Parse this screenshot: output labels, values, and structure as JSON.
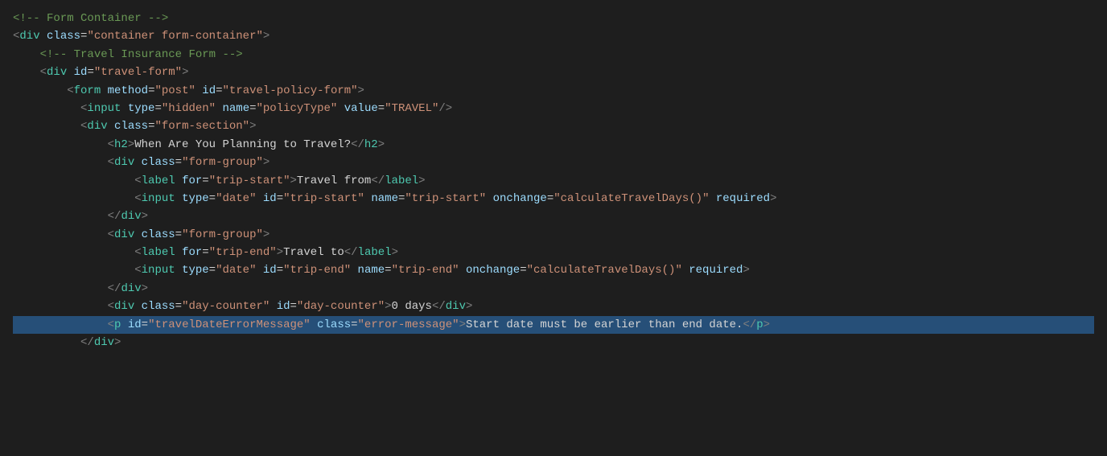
{
  "editor": {
    "background": "#1e1e1e",
    "lines": [
      {
        "id": 1,
        "highlighted": false,
        "tokens": [
          {
            "type": "comment",
            "text": "<!-- Form Container -->"
          }
        ]
      },
      {
        "id": 2,
        "highlighted": false,
        "tokens": [
          {
            "type": "bracket",
            "text": "<"
          },
          {
            "type": "element-name",
            "text": "div"
          },
          {
            "type": "plain",
            "text": " "
          },
          {
            "type": "attr-name",
            "text": "class"
          },
          {
            "type": "equals",
            "text": "="
          },
          {
            "type": "attr-value",
            "text": "\"container form-container\""
          },
          {
            "type": "bracket",
            "text": ">"
          }
        ]
      },
      {
        "id": 3,
        "highlighted": false,
        "indent": "    ",
        "tokens": [
          {
            "type": "comment",
            "text": "<!-- Travel Insurance Form -->"
          }
        ]
      },
      {
        "id": 4,
        "highlighted": false,
        "indent": "    ",
        "tokens": [
          {
            "type": "bracket",
            "text": "<"
          },
          {
            "type": "element-name",
            "text": "div"
          },
          {
            "type": "plain",
            "text": " "
          },
          {
            "type": "attr-name",
            "text": "id"
          },
          {
            "type": "equals",
            "text": "="
          },
          {
            "type": "attr-value",
            "text": "\"travel-form\""
          },
          {
            "type": "bracket",
            "text": ">"
          }
        ]
      },
      {
        "id": 5,
        "highlighted": false,
        "indent": "        ",
        "tokens": [
          {
            "type": "bracket",
            "text": "<"
          },
          {
            "type": "element-name",
            "text": "form"
          },
          {
            "type": "plain",
            "text": " "
          },
          {
            "type": "attr-name",
            "text": "method"
          },
          {
            "type": "equals",
            "text": "="
          },
          {
            "type": "attr-value",
            "text": "\"post\""
          },
          {
            "type": "plain",
            "text": " "
          },
          {
            "type": "attr-name",
            "text": "id"
          },
          {
            "type": "equals",
            "text": "="
          },
          {
            "type": "attr-value",
            "text": "\"travel-policy-form\""
          },
          {
            "type": "bracket",
            "text": ">"
          }
        ]
      },
      {
        "id": 6,
        "highlighted": false,
        "indent": "          ",
        "tokens": [
          {
            "type": "bracket",
            "text": "<"
          },
          {
            "type": "element-name",
            "text": "input"
          },
          {
            "type": "plain",
            "text": " "
          },
          {
            "type": "attr-name",
            "text": "type"
          },
          {
            "type": "equals",
            "text": "="
          },
          {
            "type": "attr-value",
            "text": "\"hidden\""
          },
          {
            "type": "plain",
            "text": " "
          },
          {
            "type": "attr-name",
            "text": "name"
          },
          {
            "type": "equals",
            "text": "="
          },
          {
            "type": "attr-value",
            "text": "\"policyType\""
          },
          {
            "type": "plain",
            "text": " "
          },
          {
            "type": "attr-name",
            "text": "value"
          },
          {
            "type": "equals",
            "text": "="
          },
          {
            "type": "attr-value",
            "text": "\"TRAVEL\""
          },
          {
            "type": "bracket",
            "text": "/>"
          }
        ]
      },
      {
        "id": 7,
        "highlighted": false,
        "indent": "          ",
        "tokens": [
          {
            "type": "bracket",
            "text": "<"
          },
          {
            "type": "element-name",
            "text": "div"
          },
          {
            "type": "plain",
            "text": " "
          },
          {
            "type": "attr-name",
            "text": "class"
          },
          {
            "type": "equals",
            "text": "="
          },
          {
            "type": "attr-value",
            "text": "\"form-section\""
          },
          {
            "type": "bracket",
            "text": ">"
          }
        ]
      },
      {
        "id": 8,
        "highlighted": false,
        "indent": "              ",
        "tokens": [
          {
            "type": "bracket",
            "text": "<"
          },
          {
            "type": "element-name",
            "text": "h2"
          },
          {
            "type": "bracket",
            "text": ">"
          },
          {
            "type": "h2-content",
            "text": "When Are You Planning to Travel?"
          },
          {
            "type": "bracket",
            "text": "</"
          },
          {
            "type": "element-name",
            "text": "h2"
          },
          {
            "type": "bracket",
            "text": ">"
          }
        ]
      },
      {
        "id": 9,
        "highlighted": false,
        "indent": "              ",
        "tokens": [
          {
            "type": "bracket",
            "text": "<"
          },
          {
            "type": "element-name",
            "text": "div"
          },
          {
            "type": "plain",
            "text": " "
          },
          {
            "type": "attr-name",
            "text": "class"
          },
          {
            "type": "equals",
            "text": "="
          },
          {
            "type": "attr-value",
            "text": "\"form-group\""
          },
          {
            "type": "bracket",
            "text": ">"
          }
        ]
      },
      {
        "id": 10,
        "highlighted": false,
        "indent": "                  ",
        "tokens": [
          {
            "type": "bracket",
            "text": "<"
          },
          {
            "type": "element-name",
            "text": "label"
          },
          {
            "type": "plain",
            "text": " "
          },
          {
            "type": "attr-name",
            "text": "for"
          },
          {
            "type": "equals",
            "text": "="
          },
          {
            "type": "attr-value",
            "text": "\"trip-start\""
          },
          {
            "type": "bracket",
            "text": ">"
          },
          {
            "type": "text-content",
            "text": "Travel from"
          },
          {
            "type": "bracket",
            "text": "</"
          },
          {
            "type": "element-name",
            "text": "label"
          },
          {
            "type": "bracket",
            "text": ">"
          }
        ]
      },
      {
        "id": 11,
        "highlighted": false,
        "indent": "                  ",
        "tokens": [
          {
            "type": "bracket",
            "text": "<"
          },
          {
            "type": "element-name",
            "text": "input"
          },
          {
            "type": "plain",
            "text": " "
          },
          {
            "type": "attr-name",
            "text": "type"
          },
          {
            "type": "equals",
            "text": "="
          },
          {
            "type": "attr-value",
            "text": "\"date\""
          },
          {
            "type": "plain",
            "text": " "
          },
          {
            "type": "attr-name",
            "text": "id"
          },
          {
            "type": "equals",
            "text": "="
          },
          {
            "type": "attr-value",
            "text": "\"trip-start\""
          },
          {
            "type": "plain",
            "text": " "
          },
          {
            "type": "attr-name",
            "text": "name"
          },
          {
            "type": "equals",
            "text": "="
          },
          {
            "type": "attr-value",
            "text": "\"trip-start\""
          },
          {
            "type": "plain",
            "text": " "
          },
          {
            "type": "attr-name",
            "text": "onchange"
          },
          {
            "type": "equals",
            "text": "="
          },
          {
            "type": "attr-value",
            "text": "\"calculateTravelDays()\""
          },
          {
            "type": "plain",
            "text": " "
          },
          {
            "type": "attr-name",
            "text": "required"
          },
          {
            "type": "bracket",
            "text": ">"
          }
        ]
      },
      {
        "id": 12,
        "highlighted": false,
        "indent": "              ",
        "tokens": [
          {
            "type": "bracket",
            "text": "</"
          },
          {
            "type": "element-name",
            "text": "div"
          },
          {
            "type": "bracket",
            "text": ">"
          }
        ]
      },
      {
        "id": 13,
        "highlighted": false,
        "indent": "              ",
        "tokens": [
          {
            "type": "bracket",
            "text": "<"
          },
          {
            "type": "element-name",
            "text": "div"
          },
          {
            "type": "plain",
            "text": " "
          },
          {
            "type": "attr-name",
            "text": "class"
          },
          {
            "type": "equals",
            "text": "="
          },
          {
            "type": "attr-value",
            "text": "\"form-group\""
          },
          {
            "type": "bracket",
            "text": ">"
          }
        ]
      },
      {
        "id": 14,
        "highlighted": false,
        "indent": "                  ",
        "tokens": [
          {
            "type": "bracket",
            "text": "<"
          },
          {
            "type": "element-name",
            "text": "label"
          },
          {
            "type": "plain",
            "text": " "
          },
          {
            "type": "attr-name",
            "text": "for"
          },
          {
            "type": "equals",
            "text": "="
          },
          {
            "type": "attr-value",
            "text": "\"trip-end\""
          },
          {
            "type": "bracket",
            "text": ">"
          },
          {
            "type": "text-content",
            "text": "Travel to"
          },
          {
            "type": "bracket",
            "text": "</"
          },
          {
            "type": "element-name",
            "text": "label"
          },
          {
            "type": "bracket",
            "text": ">"
          }
        ]
      },
      {
        "id": 15,
        "highlighted": false,
        "indent": "                  ",
        "tokens": [
          {
            "type": "bracket",
            "text": "<"
          },
          {
            "type": "element-name",
            "text": "input"
          },
          {
            "type": "plain",
            "text": " "
          },
          {
            "type": "attr-name",
            "text": "type"
          },
          {
            "type": "equals",
            "text": "="
          },
          {
            "type": "attr-value",
            "text": "\"date\""
          },
          {
            "type": "plain",
            "text": " "
          },
          {
            "type": "attr-name",
            "text": "id"
          },
          {
            "type": "equals",
            "text": "="
          },
          {
            "type": "attr-value",
            "text": "\"trip-end\""
          },
          {
            "type": "plain",
            "text": " "
          },
          {
            "type": "attr-name",
            "text": "name"
          },
          {
            "type": "equals",
            "text": "="
          },
          {
            "type": "attr-value",
            "text": "\"trip-end\""
          },
          {
            "type": "plain",
            "text": " "
          },
          {
            "type": "attr-name",
            "text": "onchange"
          },
          {
            "type": "equals",
            "text": "="
          },
          {
            "type": "attr-value",
            "text": "\"calculateTravelDays()\""
          },
          {
            "type": "plain",
            "text": " "
          },
          {
            "type": "attr-name",
            "text": "required"
          },
          {
            "type": "bracket",
            "text": ">"
          }
        ]
      },
      {
        "id": 16,
        "highlighted": false,
        "indent": "              ",
        "tokens": [
          {
            "type": "bracket",
            "text": "</"
          },
          {
            "type": "element-name",
            "text": "div"
          },
          {
            "type": "bracket",
            "text": ">"
          }
        ]
      },
      {
        "id": 17,
        "highlighted": false,
        "indent": "              ",
        "tokens": [
          {
            "type": "bracket",
            "text": "<"
          },
          {
            "type": "element-name",
            "text": "div"
          },
          {
            "type": "plain",
            "text": " "
          },
          {
            "type": "attr-name",
            "text": "class"
          },
          {
            "type": "equals",
            "text": "="
          },
          {
            "type": "attr-value",
            "text": "\"day-counter\""
          },
          {
            "type": "plain",
            "text": " "
          },
          {
            "type": "attr-name",
            "text": "id"
          },
          {
            "type": "equals",
            "text": "="
          },
          {
            "type": "attr-value",
            "text": "\"day-counter\""
          },
          {
            "type": "bracket",
            "text": ">"
          },
          {
            "type": "text-content",
            "text": "0 days"
          },
          {
            "type": "bracket",
            "text": "</"
          },
          {
            "type": "element-name",
            "text": "div"
          },
          {
            "type": "bracket",
            "text": ">"
          }
        ]
      },
      {
        "id": 18,
        "highlighted": true,
        "indent": "              ",
        "tokens": [
          {
            "type": "bracket",
            "text": "<"
          },
          {
            "type": "element-name",
            "text": "p"
          },
          {
            "type": "plain",
            "text": " "
          },
          {
            "type": "attr-name",
            "text": "id"
          },
          {
            "type": "equals",
            "text": "="
          },
          {
            "type": "attr-value",
            "text": "\"travelDateErrorMessage\""
          },
          {
            "type": "plain",
            "text": " "
          },
          {
            "type": "attr-name",
            "text": "class"
          },
          {
            "type": "equals",
            "text": "="
          },
          {
            "type": "attr-value",
            "text": "\"error-message\""
          },
          {
            "type": "bracket",
            "text": ">"
          },
          {
            "type": "text-content",
            "text": "Start date must be earlier than end date."
          },
          {
            "type": "bracket",
            "text": "</"
          },
          {
            "type": "element-name",
            "text": "p"
          },
          {
            "type": "bracket",
            "text": ">"
          }
        ]
      },
      {
        "id": 19,
        "highlighted": false,
        "indent": "          ",
        "tokens": [
          {
            "type": "bracket",
            "text": "</"
          },
          {
            "type": "element-name",
            "text": "div"
          },
          {
            "type": "bracket",
            "text": ">"
          }
        ]
      }
    ]
  }
}
